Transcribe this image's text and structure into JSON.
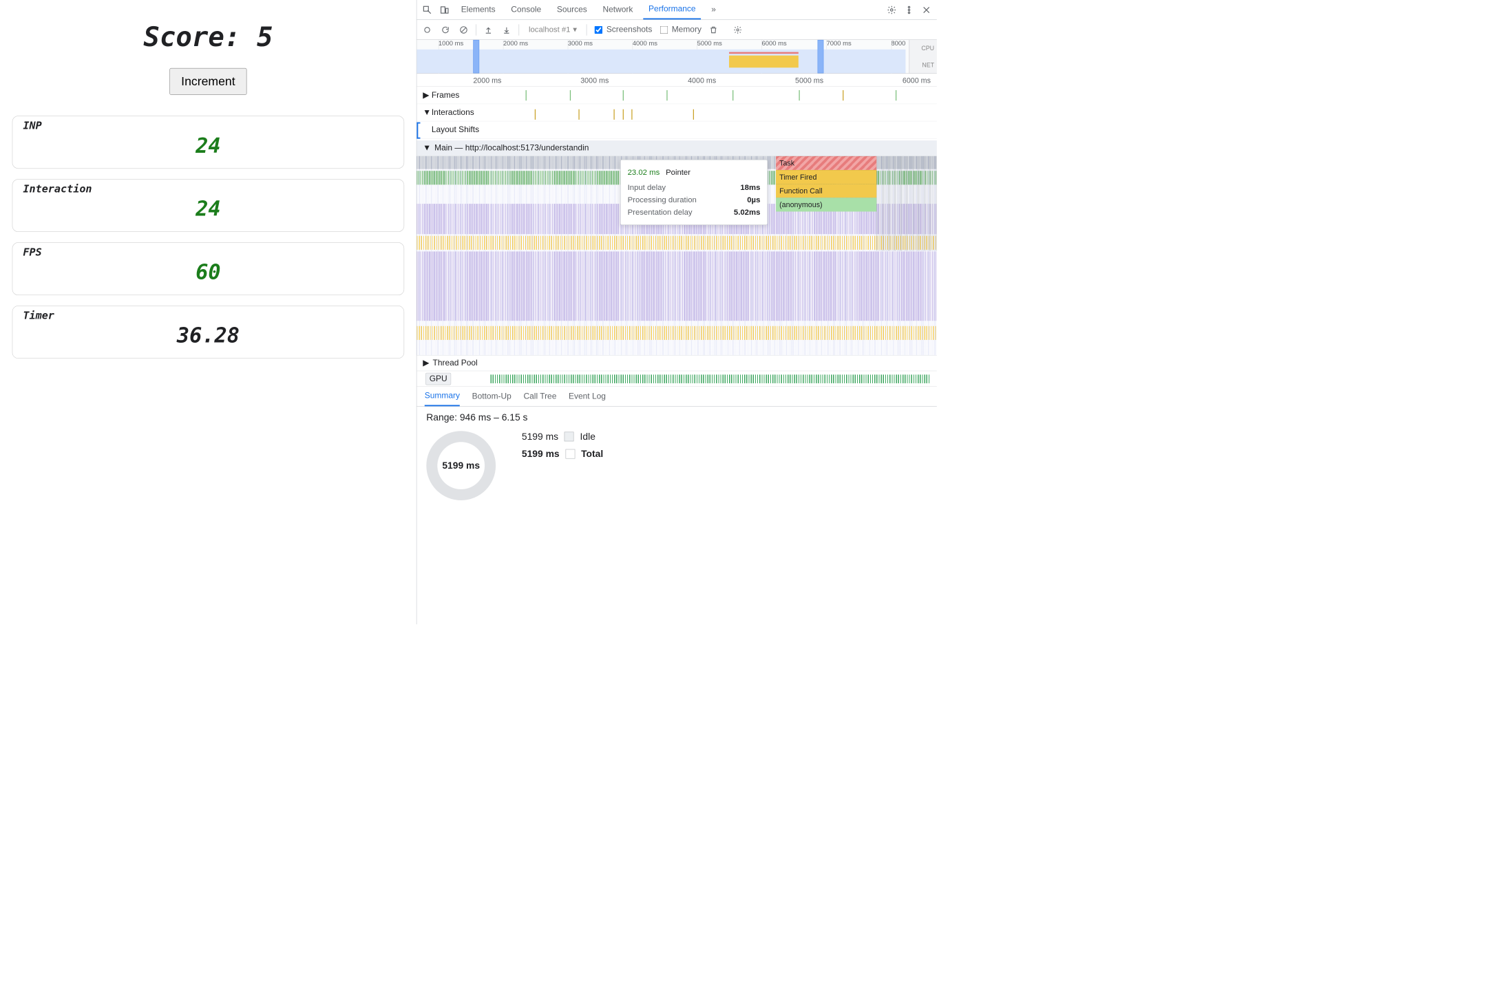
{
  "app": {
    "score_label": "Score:",
    "score_value": "5",
    "increment_label": "Increment",
    "cards": {
      "inp": {
        "label": "INP",
        "value": "24"
      },
      "interaction": {
        "label": "Interaction",
        "value": "24"
      },
      "fps": {
        "label": "FPS",
        "value": "60"
      },
      "timer": {
        "label": "Timer",
        "value": "36.28"
      }
    }
  },
  "devtools": {
    "tabs": {
      "elements": "Elements",
      "console": "Console",
      "sources": "Sources",
      "network": "Network",
      "performance": "Performance",
      "more": "»"
    },
    "toolbar": {
      "recording_dropdown": "localhost #1",
      "screenshots": "Screenshots",
      "memory": "Memory"
    },
    "overview_ticks": [
      "1000 ms",
      "2000 ms",
      "3000 ms",
      "4000 ms",
      "5000 ms",
      "6000 ms",
      "7000 ms",
      "8000"
    ],
    "overview_side": {
      "cpu": "CPU",
      "net": "NET"
    },
    "ruler_ticks": [
      "2000 ms",
      "3000 ms",
      "4000 ms",
      "5000 ms",
      "6000 ms"
    ],
    "tracks": {
      "frames": "Frames",
      "interactions": "Interactions",
      "layout_shifts": "Layout Shifts",
      "main": "Main — http://localhost:5173/understandin",
      "thread_pool": "Thread Pool",
      "gpu": "GPU"
    },
    "flame_callout": {
      "task": "Task",
      "timer_fired": "Timer Fired",
      "function_call": "Function Call",
      "anonymous": "(anonymous)"
    },
    "tooltip": {
      "duration": "23.02 ms",
      "type": "Pointer",
      "rows": {
        "input_delay": {
          "label": "Input delay",
          "value": "18ms"
        },
        "processing_duration": {
          "label": "Processing duration",
          "value": "0µs"
        },
        "presentation_delay": {
          "label": "Presentation delay",
          "value": "5.02ms"
        }
      }
    },
    "bottom_tabs": {
      "summary": "Summary",
      "bottom_up": "Bottom-Up",
      "call_tree": "Call Tree",
      "event_log": "Event Log"
    },
    "summary": {
      "range": "Range: 946 ms – 6.15 s",
      "donut_center": "5199 ms",
      "legend": {
        "idle": {
          "time": "5199 ms",
          "label": "Idle"
        },
        "total": {
          "time": "5199 ms",
          "label": "Total"
        }
      }
    }
  }
}
